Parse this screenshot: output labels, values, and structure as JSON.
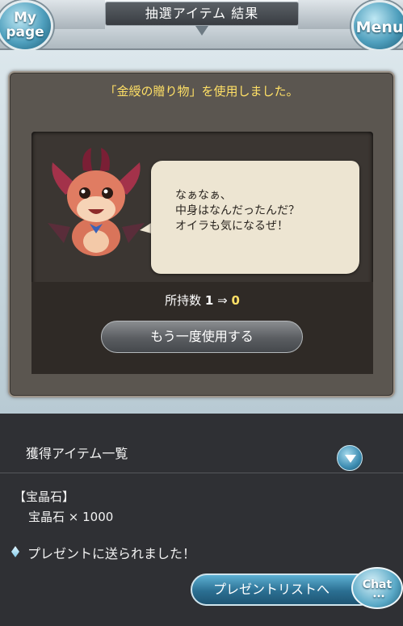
{
  "header": {
    "title": "抽選アイテム 結果",
    "mypage_line1": "My",
    "mypage_line2": "page",
    "menu_label": "Menu"
  },
  "result": {
    "used_message": "「金綬の贈り物」を使用しました。",
    "speech_line1": "なぁなぁ、",
    "speech_line2": "中身はなんだったんだ？",
    "speech_line3": "オイラも気になるぜ！",
    "count_label": "所持数",
    "count_before": "1",
    "count_arrow": "⇒",
    "count_after": "0",
    "reuse_button": "もう一度使用する"
  },
  "items": {
    "header_label": "獲得アイテム一覧",
    "category": "【宝晶石】",
    "line": "宝晶石 × 1000",
    "sent_message": "プレゼントに送られました！"
  },
  "footer": {
    "present_list_button": "プレゼントリストへ",
    "chat_label": "Chat",
    "chat_dots": "•••"
  },
  "colors": {
    "highlight": "#ffe066",
    "accent_blue": "#2b6f92"
  },
  "icons": {
    "expand": "chevron-down-icon",
    "sent": "diamond-icon"
  }
}
